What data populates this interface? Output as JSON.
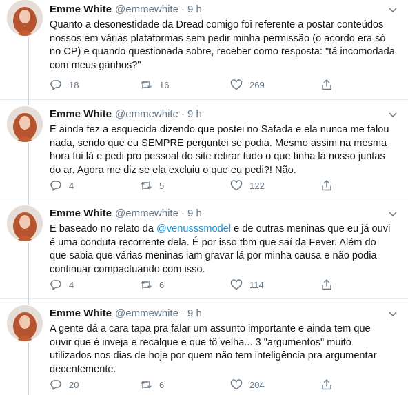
{
  "author": {
    "name": "Emme White",
    "handle": "@emmewhite",
    "separator": "·"
  },
  "tweets": [
    {
      "time": "9 h",
      "lines": [
        "Quanto a desonestidade da Dread comigo foi referente a postar conteúdos",
        "nossos em várias plataformas sem pedir minha permissão (o acordo era só",
        "no CP) e quando questionada sobre, receber como resposta: \"tá incomodada",
        "com meus ganhos?\""
      ],
      "replies": "18",
      "retweets": "16",
      "likes": "269"
    },
    {
      "time": "9 h",
      "lines": [
        "E ainda fez a esquecida dizendo que postei no Safada e ela nunca me falou",
        "nada, sendo que eu SEMPRE perguntei se podia. Mesmo assim na mesma",
        "hora fui lá e pedi pro pessoal do site retirar tudo o que tinha lá nosso juntas",
        "do ar. Agora me diz se ela excluiu o que eu pedi?! Não."
      ],
      "replies": "4",
      "retweets": "5",
      "likes": "122"
    },
    {
      "time": "9 h",
      "line1_before": "E baseado no relato da ",
      "mention": "@venusssmodel",
      "line1_after": " e de outras meninas que eu já ouvi",
      "lines": [
        "é uma conduta recorrente dela. É por isso tbm que saí da Fever. Além do",
        "que sabia que várias meninas iam gravar lá por minha causa e não podia",
        "continuar compactuando com isso."
      ],
      "replies": "4",
      "retweets": "6",
      "likes": "114"
    },
    {
      "time": "9 h",
      "lines": [
        "A gente dá a cara tapa pra falar um assunto importante e ainda tem que",
        "ouvir que é inveja e recalque e que tô velha... 3 \"argumentos\" muito",
        "utilizados nos dias de hoje por quem não tem inteligência pra argumentar",
        "decentemente."
      ],
      "replies": "20",
      "retweets": "6",
      "likes": "204"
    }
  ],
  "colors": {
    "text": "#14171a",
    "secondary": "#657786",
    "link": "#1b95e0",
    "thread_line": "#ccd6dd",
    "divider": "#e6ecf0"
  },
  "icons": [
    "caret-down-icon",
    "reply-icon",
    "retweet-icon",
    "like-icon",
    "share-icon"
  ]
}
